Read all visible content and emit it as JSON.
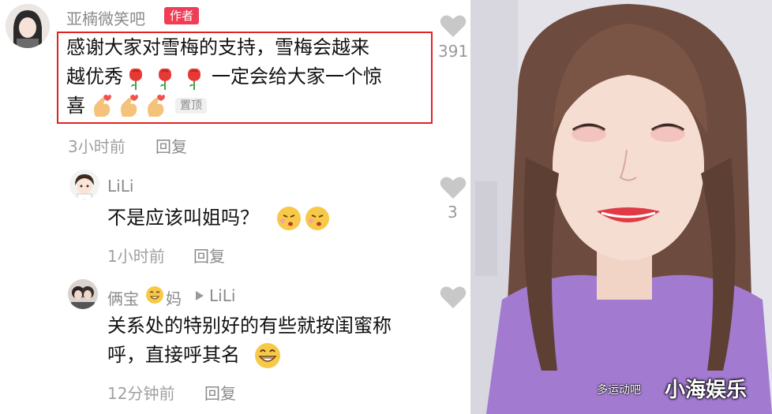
{
  "comment": {
    "author": "亚楠微笑吧",
    "author_badge": "作者",
    "text_line1": "感谢大家对雪梅的支持，雪梅会越来",
    "text_line2a": "越优秀",
    "text_line2b": "一定会给大家一个惊",
    "text_line3": "喜",
    "pinned_label": "置顶",
    "time": "3小时前",
    "reply_label": "回复",
    "likes": "391"
  },
  "reply1": {
    "author": "LiLi",
    "text": "不是应该叫姐吗？",
    "time": "1小时前",
    "reply_label": "回复",
    "likes": "3"
  },
  "reply2": {
    "author_a": "俩宝",
    "author_b": "妈",
    "reply_to": "LiLi",
    "text_line1": "关系处的特别好的有些就按闺蜜称",
    "text_line2": "呼，直接呼其名",
    "time": "12分钟前",
    "reply_label": "回复"
  },
  "video": {
    "caption": "多运动吧",
    "watermark": "小海娱乐"
  },
  "colors": {
    "badge": "#ee3d55",
    "highlight_border": "#e02424",
    "heart": "#c8c8c8",
    "video_shirt": "#a27ad0"
  },
  "icons": [
    "heart-icon",
    "rose-icon",
    "finger-heart-icon",
    "grin-icon",
    "kiss-icon",
    "play-arrow-icon"
  ]
}
